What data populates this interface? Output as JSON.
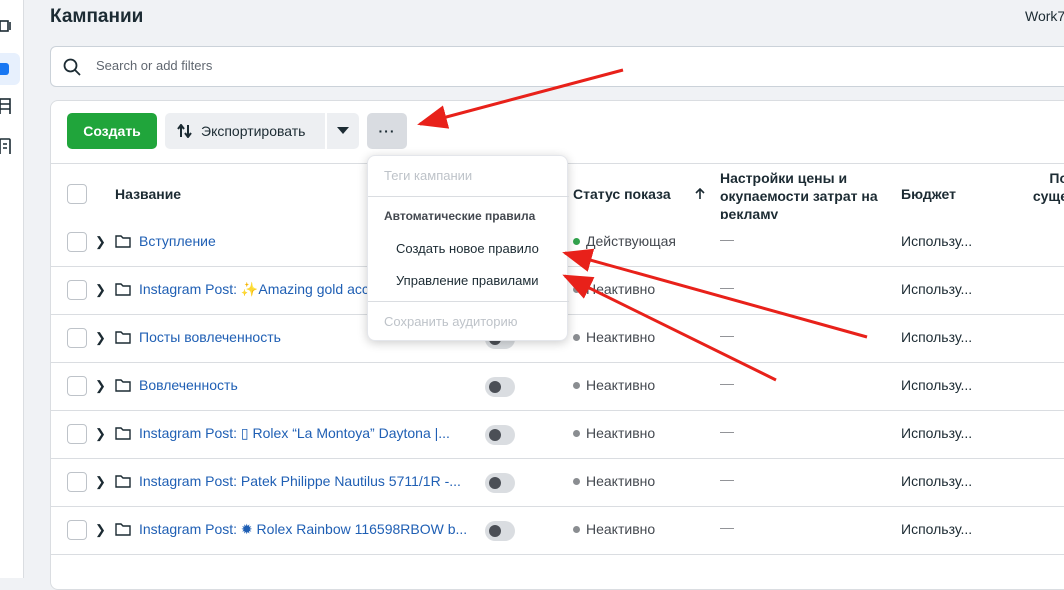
{
  "page": {
    "title": "Кампании",
    "account": "Work7"
  },
  "search": {
    "placeholder": "Search or add filters"
  },
  "toolbar": {
    "create_label": "Создать",
    "export_label": "Экспортировать",
    "more_label": "···"
  },
  "table": {
    "headers": {
      "name": "Название",
      "status": "Статус показа",
      "bid": "Настройки цены и окупаемости затрат на рекламу",
      "budget": "Бюджет",
      "last": "По суще"
    },
    "rows": [
      {
        "name": "Вступление",
        "status": "Действующая",
        "status_color": "#31a24c",
        "bid": "—",
        "budget": "Использу..."
      },
      {
        "name": "Instagram Post: ✨Amazing gold acc",
        "status": "Неактивно",
        "status_color": "#8a8d91",
        "bid": "—",
        "budget": "Использу..."
      },
      {
        "name": "Посты вовлеченность",
        "status": "Неактивно",
        "status_color": "#8a8d91",
        "bid": "—",
        "budget": "Использу..."
      },
      {
        "name": "Вовлеченность",
        "status": "Неактивно",
        "status_color": "#8a8d91",
        "bid": "—",
        "budget": "Использу..."
      },
      {
        "name": "Instagram Post: ▯ Rolex “La Montoya” Daytona |...",
        "status": "Неактивно",
        "status_color": "#8a8d91",
        "bid": "—",
        "budget": "Использу..."
      },
      {
        "name": "Instagram Post: Patek Philippe Nautilus 5711/1R -...",
        "status": "Неактивно",
        "status_color": "#8a8d91",
        "bid": "—",
        "budget": "Использу..."
      },
      {
        "name": "Instagram Post: ✹ Rolex Rainbow 116598RBOW b...",
        "status": "Неактивно",
        "status_color": "#8a8d91",
        "bid": "—",
        "budget": "Использу..."
      }
    ]
  },
  "menu": {
    "tags": "Теги кампании",
    "section": "Автоматические правила",
    "new_rule": "Создать новое правило",
    "manage_rules": "Управление правилами",
    "save_audience": "Сохранить аудиторию"
  },
  "colors": {
    "accent": "#1877f2",
    "create": "#20a53b",
    "annotation": "#e8211a"
  }
}
